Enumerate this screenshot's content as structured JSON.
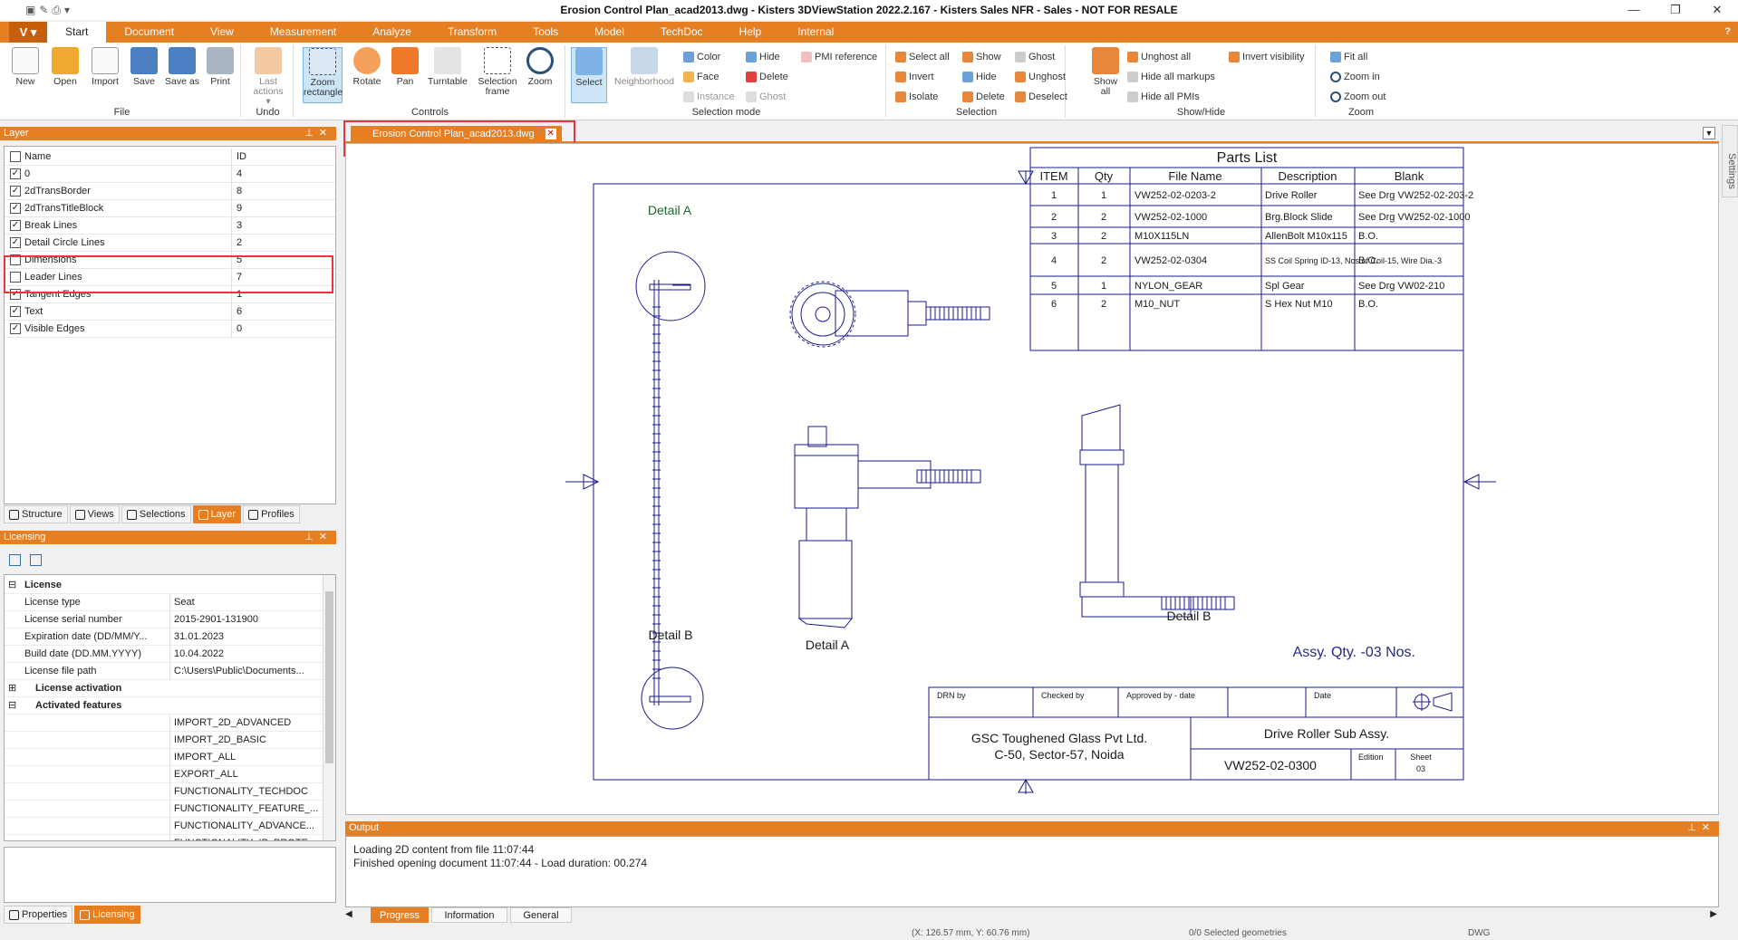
{
  "window": {
    "title": "Erosion Control Plan_acad2013.dwg - Kisters 3DViewStation 2022.2.167 - Kisters Sales NFR - Sales - NOT FOR RESALE",
    "minimize": "—",
    "maximize": "❐",
    "close": "✕"
  },
  "menu": {
    "app_button": "V ▾",
    "tabs": [
      "Start",
      "Document",
      "View",
      "Measurement",
      "Analyze",
      "Transform",
      "Tools",
      "Model",
      "TechDoc",
      "Help",
      "Internal"
    ],
    "help": "?"
  },
  "ribbon": {
    "file": {
      "label": "File",
      "new": "New",
      "open": "Open",
      "import": "Import",
      "save": "Save",
      "save_as": "Save as",
      "print": "Print"
    },
    "undo": {
      "label": "Undo",
      "last_actions": "Last actions ▾"
    },
    "controls": {
      "label": "Controls",
      "zoom_rect": "Zoom rectangle",
      "rotate": "Rotate",
      "pan": "Pan",
      "turntable": "Turntable",
      "selection_frame": "Selection frame",
      "zoom": "Zoom"
    },
    "selection_mode": {
      "label": "Selection mode",
      "select": "Select",
      "neighborhood": "Neighborhood",
      "color": "Color",
      "face": "Face",
      "instance": "Instance",
      "hide": "Hide",
      "delete": "Delete",
      "ghost": "Ghost",
      "pmi_reference": "PMI reference"
    },
    "selection": {
      "label": "Selection",
      "select_all": "Select all",
      "invert": "Invert",
      "isolate": "Isolate",
      "show": "Show",
      "hide": "Hide",
      "delete": "Delete",
      "ghost": "Ghost",
      "unghost": "Unghost",
      "deselect": "Deselect"
    },
    "show_hide": {
      "label": "Show/Hide",
      "show_all": "Show all",
      "unghost_all": "Unghost all",
      "hide_all_markups": "Hide all markups",
      "hide_all_pmis": "Hide all PMIs",
      "invert_visibility": "Invert visibility"
    },
    "zoom": {
      "label": "Zoom",
      "fit_all": "Fit all",
      "zoom_in": "Zoom in",
      "zoom_out": "Zoom out"
    }
  },
  "layer_panel": {
    "title": "Layer",
    "col_name": "Name",
    "col_id": "ID",
    "rows": [
      {
        "name": "0",
        "id": "4",
        "checked": true
      },
      {
        "name": "2dTransBorder",
        "id": "8",
        "checked": true
      },
      {
        "name": "2dTransTitleBlock",
        "id": "9",
        "checked": true
      },
      {
        "name": "Break Lines",
        "id": "3",
        "checked": true
      },
      {
        "name": "Detail Circle Lines",
        "id": "2",
        "checked": true
      },
      {
        "name": "Dimensions",
        "id": "5",
        "checked": false
      },
      {
        "name": "Leader Lines",
        "id": "7",
        "checked": false
      },
      {
        "name": "Tangent Edges",
        "id": "1",
        "checked": true
      },
      {
        "name": "Text",
        "id": "6",
        "checked": true
      },
      {
        "name": "Visible Edges",
        "id": "0",
        "checked": true
      }
    ],
    "tabs": [
      "Structure",
      "Views",
      "Selections",
      "Layer",
      "Profiles"
    ]
  },
  "licensing_panel": {
    "title": "Licensing",
    "rows": [
      {
        "key": "License",
        "value": "",
        "header": true,
        "toggle": "⊟"
      },
      {
        "key": "License type",
        "value": "Seat"
      },
      {
        "key": "License serial number",
        "value": "2015-2901-131900"
      },
      {
        "key": "Expiration date (DD/MM/Y...",
        "value": "31.01.2023"
      },
      {
        "key": "Build date (DD.MM.YYYY)",
        "value": "10.04.2022"
      },
      {
        "key": "License file path",
        "value": "C:\\Users\\Public\\Documents..."
      },
      {
        "key": "License activation",
        "value": "",
        "header": true,
        "toggle": "⊞"
      },
      {
        "key": "Activated features",
        "value": "",
        "header": true,
        "toggle": "⊟"
      },
      {
        "key": "",
        "value": "IMPORT_2D_ADVANCED"
      },
      {
        "key": "",
        "value": "IMPORT_2D_BASIC"
      },
      {
        "key": "",
        "value": "IMPORT_ALL"
      },
      {
        "key": "",
        "value": "EXPORT_ALL"
      },
      {
        "key": "",
        "value": "FUNCTIONALITY_TECHDOC"
      },
      {
        "key": "",
        "value": "FUNCTIONALITY_FEATURE_..."
      },
      {
        "key": "",
        "value": "FUNCTIONALITY_ADVANCE..."
      },
      {
        "key": "",
        "value": "FUNCTIONALITY_IP_PROTE..."
      }
    ],
    "tabs": [
      "Properties",
      "Licensing"
    ]
  },
  "document": {
    "tab_label": "Erosion Control Plan_acad2013.dwg",
    "settings_label": "Settings"
  },
  "drawing": {
    "parts_list_title": "Parts List",
    "headers": [
      "ITEM",
      "Qty",
      "File Name",
      "Description",
      "Blank"
    ],
    "rows": [
      [
        "1",
        "1",
        "VW252-02-0203-2",
        "Drive Roller",
        "See Drg VW252-02-203-2"
      ],
      [
        "2",
        "2",
        "VW252-02-1000",
        "Brg.Block Slide",
        "See Drg VW252-02-1000"
      ],
      [
        "3",
        "2",
        "M10X115LN",
        "AllenBolt M10x115",
        "B.O."
      ],
      [
        "4",
        "2",
        "VW252-02-0304",
        "SS Coil Spring ID-13, Nos of Coil-15, Wire Dia.-3",
        "B.O."
      ],
      [
        "5",
        "1",
        "NYLON_GEAR",
        "Spl Gear",
        "See Drg VW02-210"
      ],
      [
        "6",
        "2",
        "M10_NUT",
        "S Hex Nut M10",
        "B.O."
      ]
    ],
    "detail_a_top": "Detail A",
    "detail_b_left": "Detail B",
    "detail_a_center": "Detail A",
    "detail_b_right": "Detail B",
    "assy_qty": "Assy. Qty. -03 Nos.",
    "tb_drn": "DRN by",
    "tb_checked": "Checked by",
    "tb_approved": "Approved by - date",
    "tb_date": "Date",
    "company_line1": "GSC Toughened Glass Pvt Ltd.",
    "company_line2": "C-50, Sector-57, Noida",
    "drawing_title": "Drive Roller Sub Assy.",
    "drawing_number": "VW252-02-0300",
    "edition_label": "Edition",
    "sheet_label": "Sheet",
    "sheet_value": "03"
  },
  "output": {
    "title": "Output",
    "lines": [
      "Loading 2D content from file 11:07:44",
      "Finished opening document 11:07:44 - Load duration: 00.274"
    ],
    "tabs": [
      "Progress",
      "Information",
      "General"
    ]
  },
  "status": {
    "coords": "(X: 126.57 mm, Y: 60.76 mm)",
    "selected": "0/0 Selected geometries",
    "format": "DWG"
  },
  "colors": {
    "accent": "#e67e22",
    "highlight": "#e5373d",
    "drawing_text": "#1a1a8c"
  }
}
